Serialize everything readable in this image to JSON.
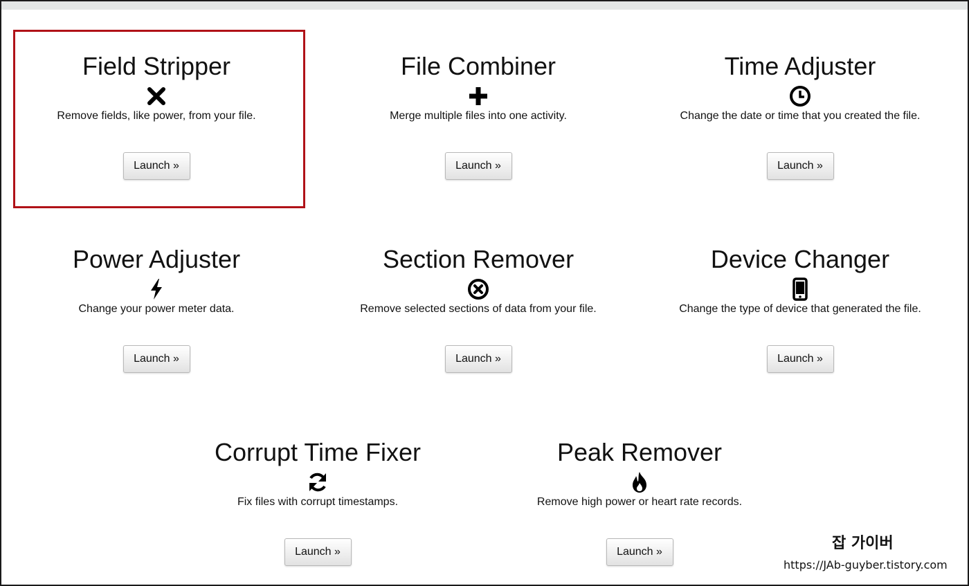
{
  "tools": [
    {
      "title": "Field Stripper",
      "icon": "x-mark-icon",
      "description": "Remove fields, like power, from your file.",
      "button": "Launch »"
    },
    {
      "title": "File Combiner",
      "icon": "plus-icon",
      "description": "Merge multiple files into one activity.",
      "button": "Launch »"
    },
    {
      "title": "Time Adjuster",
      "icon": "clock-icon",
      "description": "Change the date or time that you created the file.",
      "button": "Launch »"
    },
    {
      "title": "Power Adjuster",
      "icon": "lightning-icon",
      "description": "Change your power meter data.",
      "button": "Launch »"
    },
    {
      "title": "Section Remover",
      "icon": "circle-x-icon",
      "description": "Remove selected sections of data from your file.",
      "button": "Launch »"
    },
    {
      "title": "Device Changer",
      "icon": "phone-icon",
      "description": "Change the type of device that generated the file.",
      "button": "Launch »"
    },
    {
      "title": "Corrupt Time Fixer",
      "icon": "refresh-icon",
      "description": "Fix files with corrupt timestamps.",
      "button": "Launch »"
    },
    {
      "title": "Peak Remover",
      "icon": "fire-icon",
      "description": "Remove high power or heart rate records.",
      "button": "Launch »"
    }
  ],
  "watermark": {
    "title": "잡 가이버",
    "url": "https://JAb-guyber.tistory.com"
  },
  "colors": {
    "highlight_border": "#b01218",
    "top_bar": "#e3e6e5"
  }
}
